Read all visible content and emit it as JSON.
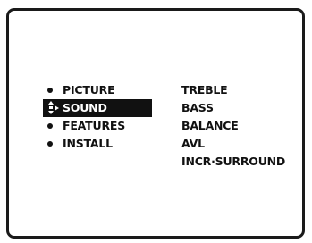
{
  "main_menu": {
    "items": [
      {
        "label": "PICTURE",
        "selected": false
      },
      {
        "label": "SOUND",
        "selected": true
      },
      {
        "label": "FEATURES",
        "selected": false
      },
      {
        "label": "INSTALL",
        "selected": false
      }
    ]
  },
  "sound_submenu": {
    "items": [
      {
        "label": "TREBLE"
      },
      {
        "label": "BASS"
      },
      {
        "label": "BALANCE"
      },
      {
        "label": "AVL"
      },
      {
        "label": "INCR·SURROUND"
      }
    ]
  },
  "colors": {
    "background": "#ffffff",
    "frame": "#1a1a1a",
    "text": "#111111",
    "highlight_bg": "#111111",
    "highlight_text": "#ffffff"
  },
  "icons": {
    "bullet": "bullet-dot-icon",
    "selection": "navigation-cursor-icon"
  }
}
